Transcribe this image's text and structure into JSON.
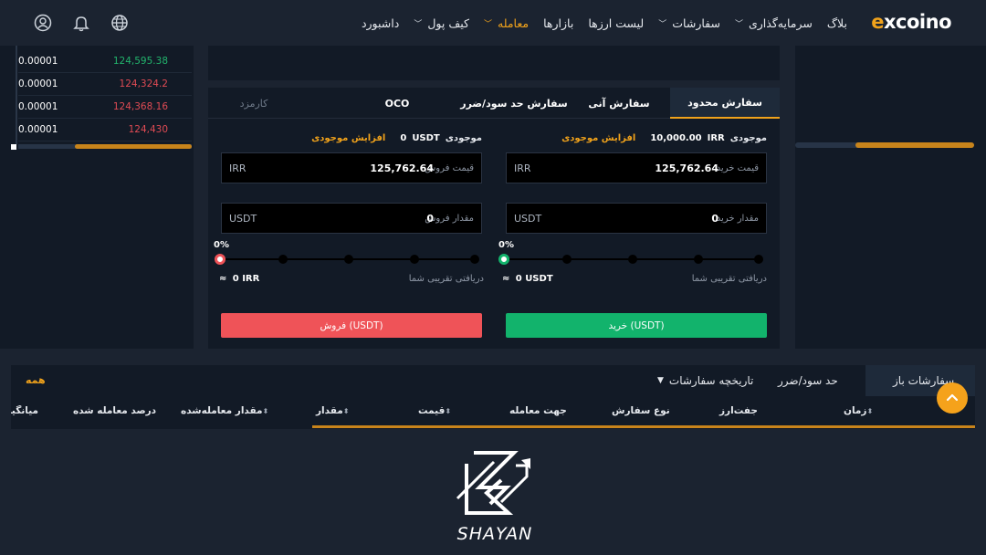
{
  "header": {
    "logo_text": "xcoino",
    "logo_accent": "e",
    "nav": [
      {
        "label": "داشبورد",
        "has_chevron": false,
        "active": false
      },
      {
        "label": "کیف پول",
        "has_chevron": true,
        "active": false
      },
      {
        "label": "معامله",
        "has_chevron": true,
        "active": true
      },
      {
        "label": "بازارها",
        "has_chevron": false,
        "active": false
      },
      {
        "label": "لیست ارزها",
        "has_chevron": false,
        "active": false
      },
      {
        "label": "سفارشات",
        "has_chevron": true,
        "active": false
      },
      {
        "label": "سرمایه‌گذاری",
        "has_chevron": true,
        "active": false
      },
      {
        "label": "بلاگ",
        "has_chevron": false,
        "active": false
      }
    ],
    "icons": [
      "globe-icon",
      "bell-icon",
      "user-icon"
    ]
  },
  "orderbook": {
    "rows": [
      {
        "amount": "0.00001",
        "price": "124,595.38",
        "side": "buy"
      },
      {
        "amount": "0.00001",
        "price": "124,324.2",
        "side": "sell"
      },
      {
        "amount": "0.00001",
        "price": "124,368.16",
        "side": "sell"
      },
      {
        "amount": "0.00001",
        "price": "124,430",
        "side": "sell"
      }
    ]
  },
  "trade": {
    "tabs": [
      "سفارش محدود",
      "سفارش آنی",
      "سفارش حد سود/ضرر",
      "OCO",
      "کارمزد"
    ],
    "buy": {
      "balance_label": "موجودی",
      "balance_unit": "IRR",
      "balance_value": "10,000.00",
      "increase_label": "افزایش موجودی",
      "price_placeholder": "قیمت خرید",
      "price_value": "125,762.64",
      "price_unit": "IRR",
      "amount_placeholder": "مقدار خرید",
      "amount_value": "0",
      "amount_unit": "USDT",
      "percent": "0%",
      "receive_label": "دریافتی تقریبی شما",
      "receive_value": "0 USDT",
      "approx": "≈",
      "button_label": "خرید (USDT)"
    },
    "sell": {
      "balance_label": "موجودی",
      "balance_unit": "USDT",
      "balance_value": "0",
      "increase_label": "افزایش موجودی",
      "price_placeholder": "قیمت فروش",
      "price_value": "125,762.64",
      "price_unit": "IRR",
      "amount_placeholder": "مقدار فروش",
      "amount_value": "0",
      "amount_unit": "USDT",
      "percent": "0%",
      "receive_label": "دریافتی تقریبی شما",
      "receive_value": "0 IRR",
      "approx": "≈",
      "button_label": "فروش (USDT)"
    }
  },
  "orders": {
    "tabs": [
      "سفارشات باز",
      "حد سود/ضرر",
      "تاریخچه سفارشات"
    ],
    "all_label": "همه",
    "columns": [
      "زمان",
      "جفت‌ارز",
      "نوع سفارش",
      "جهت معامله",
      "قیمت",
      "مقدار",
      "مقدار معامله‌شده",
      "درصد معامله شده",
      "میانگین"
    ]
  },
  "watermark": {
    "text": "SHAYAN"
  },
  "colors": {
    "accent": "#f0a21b",
    "buy": "#12b36c",
    "sell": "#ef5358",
    "bg": "#1b2330",
    "panel": "#121a26"
  }
}
